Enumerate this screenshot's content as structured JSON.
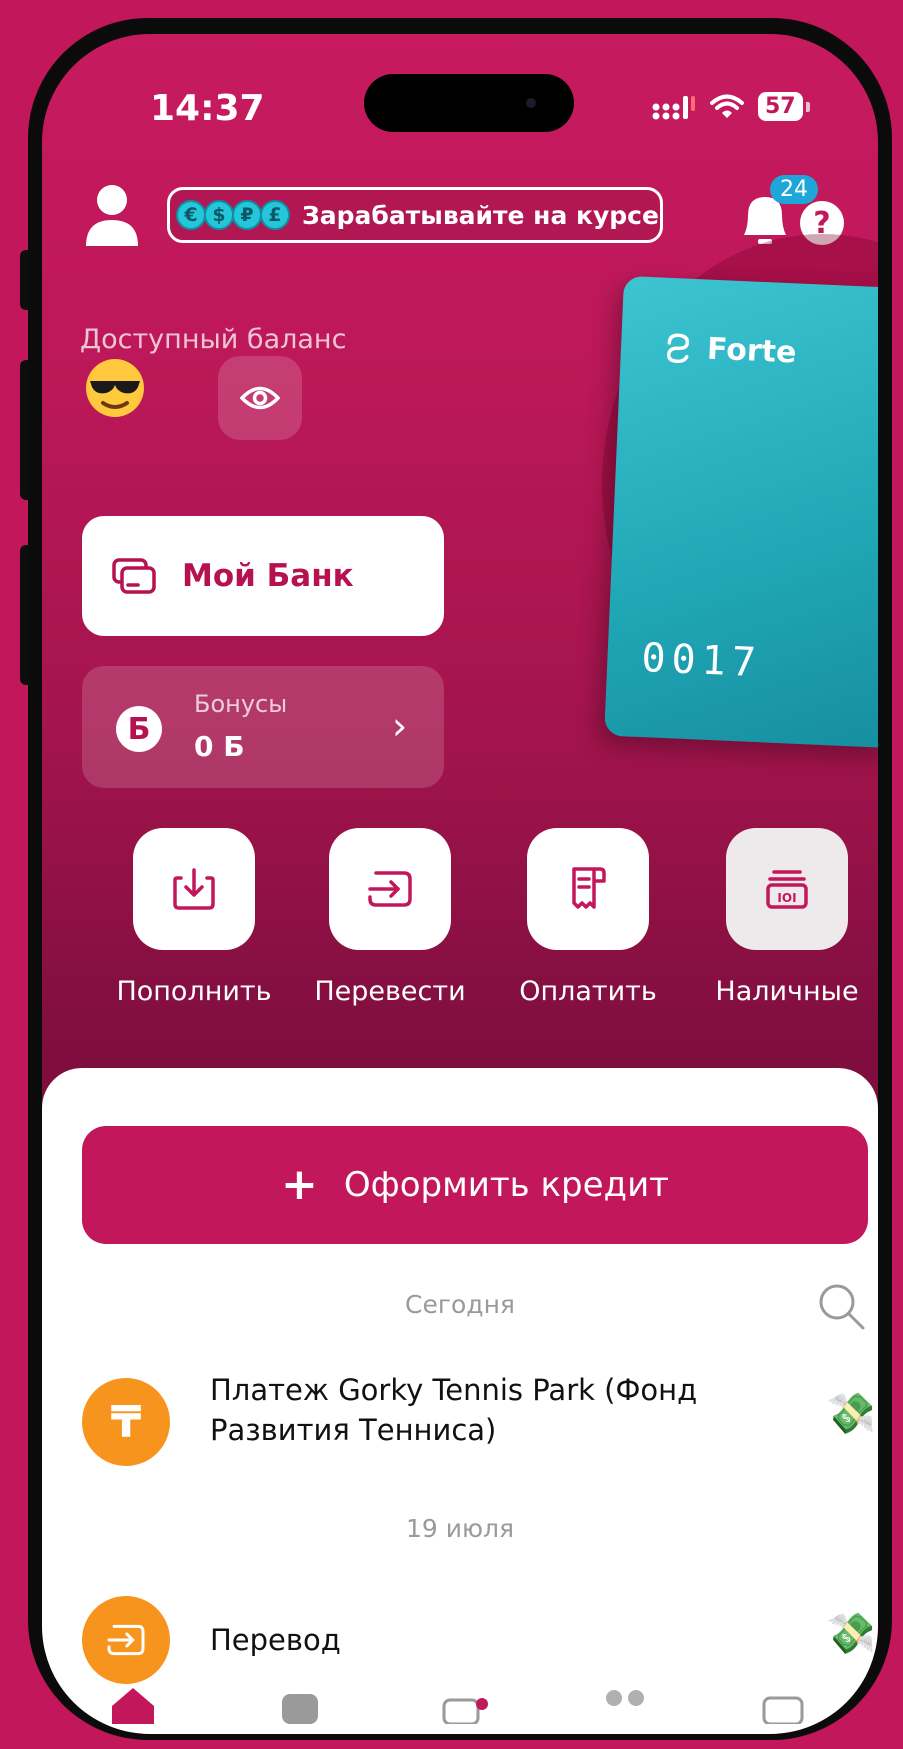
{
  "status_bar": {
    "time": "14:37",
    "battery": "57"
  },
  "header": {
    "promo_text": "Зарабатывайте на курсе в",
    "promo_coins": [
      "€",
      "$",
      "₽",
      "£"
    ],
    "notification_count": "24",
    "help_label": "?"
  },
  "balance": {
    "label": "Доступный баланс",
    "hidden_emoji": "😎"
  },
  "card": {
    "brand": "Forte",
    "last_digits": "0017",
    "color": "#26b3c4"
  },
  "my_bank": {
    "label": "Мой Банк"
  },
  "bonus": {
    "label": "Бонусы",
    "value": "0 Б",
    "icon_letter": "Б"
  },
  "actions": [
    {
      "label": "Пополнить",
      "icon": "top-up-icon"
    },
    {
      "label": "Перевести",
      "icon": "transfer-icon"
    },
    {
      "label": "Оплатить",
      "icon": "pay-icon"
    },
    {
      "label": "Наличные",
      "icon": "cash-icon"
    }
  ],
  "credit_button": {
    "plus": "+",
    "label": "Оформить кредит"
  },
  "transactions": [
    {
      "date": "Сегодня",
      "title": "Платеж Gorky Tennis Park (Фонд Развития Тенниса)",
      "icon": "tenge-icon",
      "icon_glyph": "₸"
    },
    {
      "date": "19 июля",
      "title": "Перевод",
      "icon": "transfer-icon"
    }
  ],
  "colors": {
    "brand": "#c2185b",
    "accent_orange": "#f7941d",
    "card": "#26b3c4"
  }
}
